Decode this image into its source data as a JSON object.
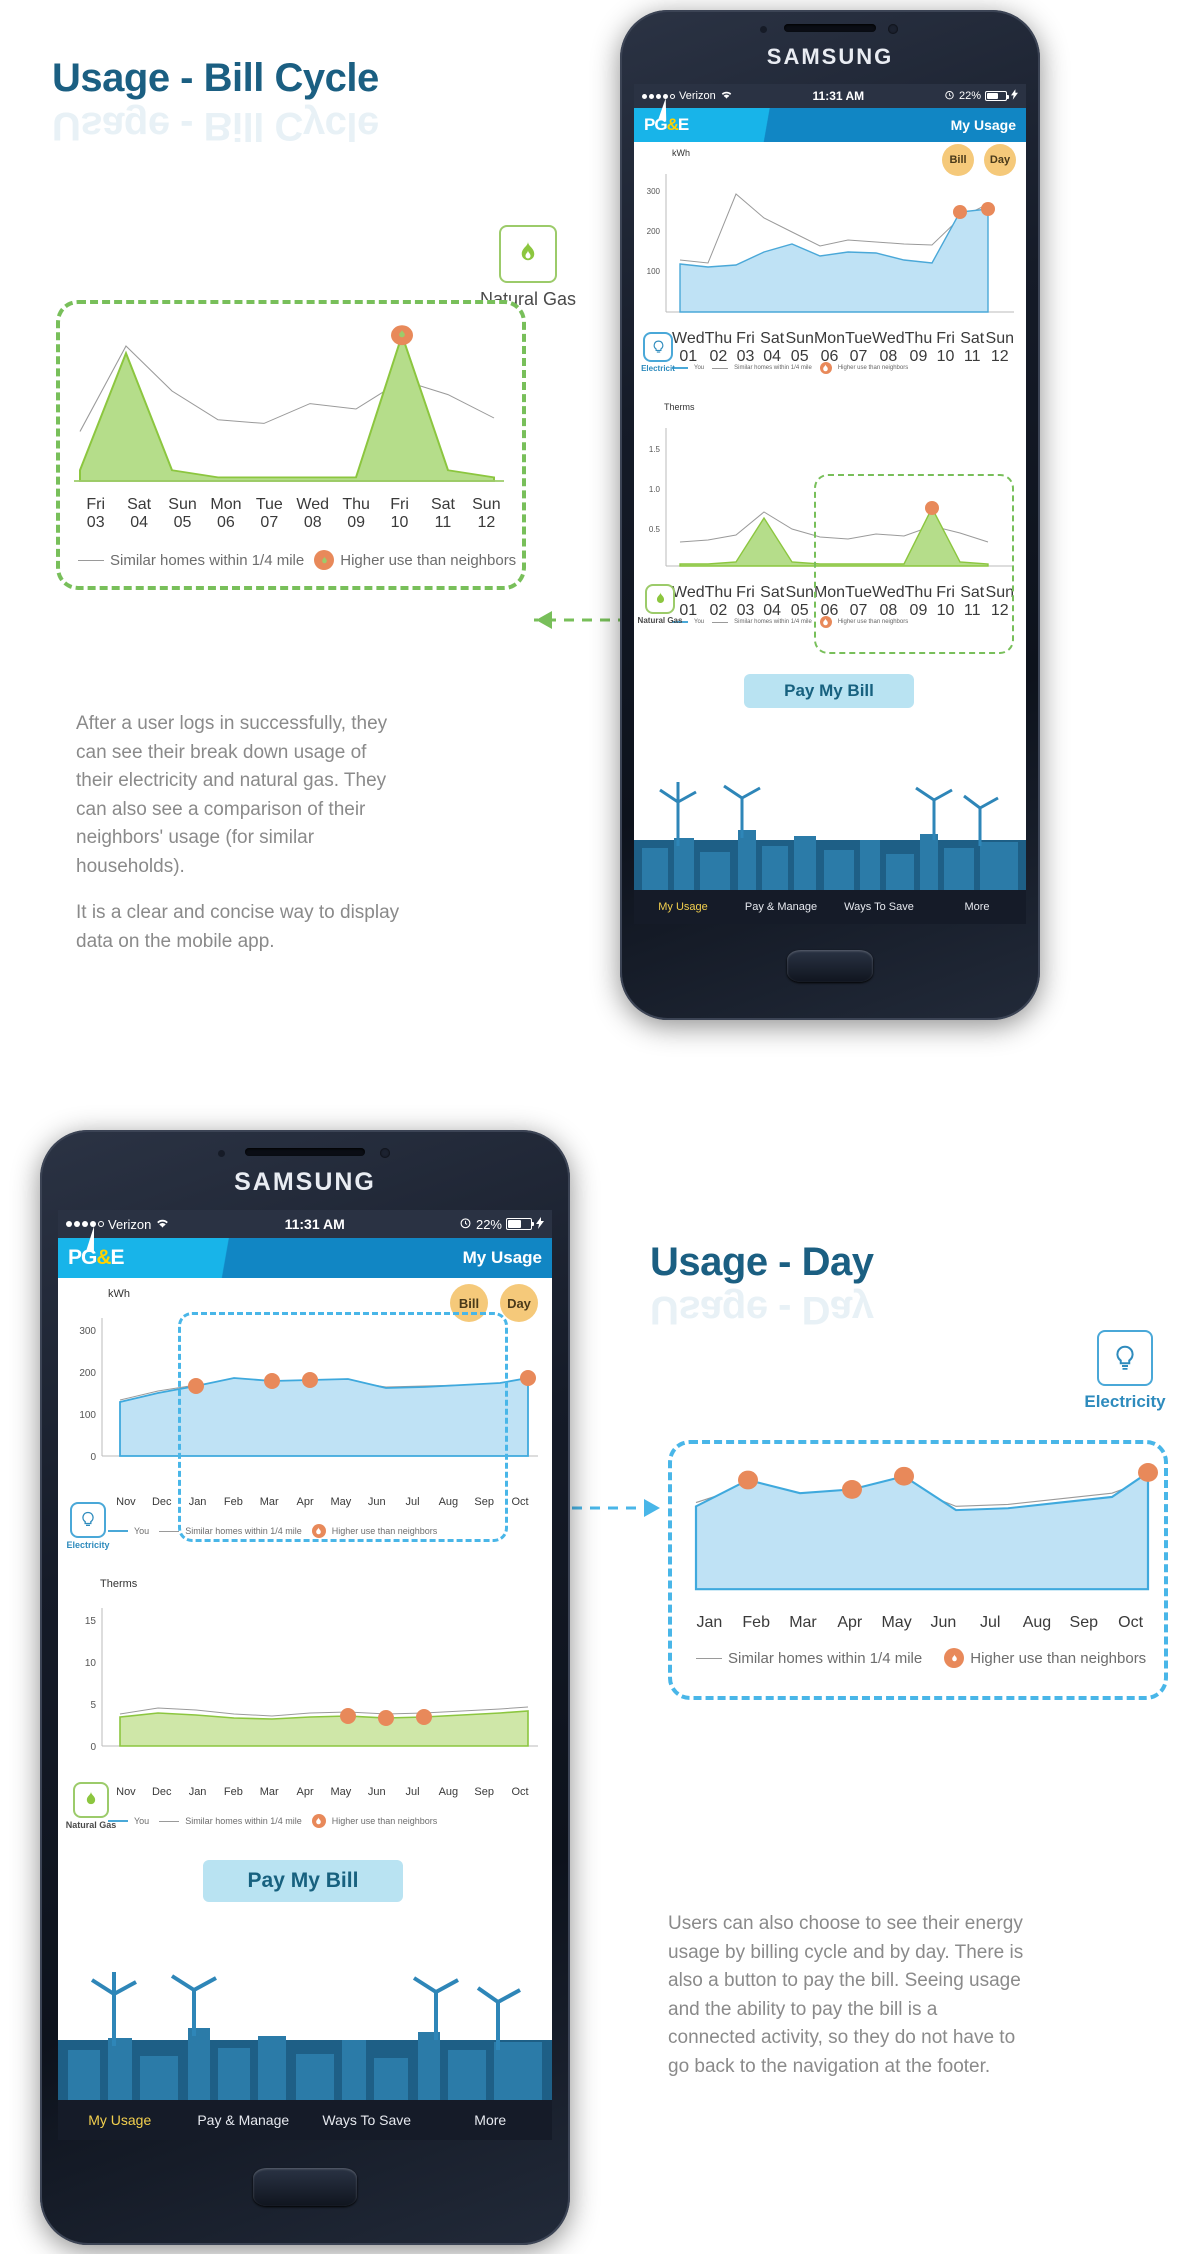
{
  "page": {
    "section1_title": "Usage - Bill Cycle",
    "section2_title": "Usage - Day",
    "body1_p1": "After a user logs in successfully, they can see their break down usage of their electricity and natural gas. They can also see a comparison of their neighbors' usage (for similar households).",
    "body1_p2": "It is a clear and concise way to display data on the mobile app.",
    "body2_p1": "Users can also choose to see their energy usage by billing cycle and by day. There is also a button to pay the bill. Seeing usage and the ability to pay the bill is a connected activity, so they do not have to go back to the navigation at the footer."
  },
  "colors": {
    "title_blue": "#1b5f82",
    "green_accent": "#78bf5a",
    "green_fill": "#b5dd8a",
    "blue_accent": "#49b6e8",
    "blue_fill": "#bfe2f5",
    "pin_orange": "#e8895a",
    "pge_cyan": "#18b4e9",
    "pge_blue": "#1186c4",
    "pill_amber": "#f5c97a",
    "pay_btn_bg": "#b9e3f2",
    "nav_active": "#f3d04e"
  },
  "device": {
    "brand": "SAMSUNG",
    "statusbar": {
      "carrier": "Verizon",
      "time": "11:31 AM",
      "battery_pct": "22%",
      "signal_dots_filled": 4,
      "signal_dots_total": 5,
      "wifi_icon": "wifi-icon",
      "alarm_icon": "alarm-clock-icon",
      "charging_icon": "lightning-bolt-icon"
    },
    "app_header": {
      "logo_pg": "PG",
      "logo_amp": "&",
      "logo_e": "E",
      "title": "My Usage"
    },
    "toggles": {
      "bill": "Bill",
      "day": "Day"
    },
    "pay_button": "Pay My Bill",
    "bottom_nav": [
      {
        "label": "My Usage",
        "active": true
      },
      {
        "label": "Pay & Manage",
        "active": false
      },
      {
        "label": "Ways To Save",
        "active": false
      },
      {
        "label": "More",
        "active": false
      }
    ]
  },
  "fuel": {
    "electricity_label": "Electricity",
    "electricity_label_short": "Electricit",
    "natural_gas_label": "Natural Gas",
    "electricity_icon": "lightbulb-icon",
    "natural_gas_icon": "gas-flame-icon"
  },
  "legend": {
    "you": "You",
    "similar": "Similar homes within 1/4 mile",
    "higher": "Higher use than neighbors",
    "pin_icon": "flame-pin-icon"
  },
  "chart_data": [
    {
      "id": "callout-bill-cycle-gas",
      "type": "area",
      "title": "Natural Gas",
      "ylabel": "",
      "xlabel": "",
      "categories": [
        "Fri\n03",
        "Sat\n04",
        "Sun\n05",
        "Mon\n06",
        "Tue\n07",
        "Wed\n08",
        "Thu\n09",
        "Fri\n10",
        "Sat\n11",
        "Sun\n12"
      ],
      "tick_days": [
        "Fri",
        "Sat",
        "Sun",
        "Mon",
        "Tue",
        "Wed",
        "Thu",
        "Fri",
        "Sat",
        "Sun"
      ],
      "tick_nums": [
        "03",
        "04",
        "05",
        "06",
        "07",
        "08",
        "09",
        "10",
        "11",
        "12"
      ],
      "series": [
        {
          "name": "You",
          "values": [
            0.05,
            0.72,
            0.05,
            0.03,
            0.03,
            0.03,
            0.03,
            0.95,
            0.05,
            0.03
          ]
        },
        {
          "name": "Similar homes within 1/4 mile",
          "values": [
            0.3,
            0.85,
            0.58,
            0.4,
            0.38,
            0.47,
            0.45,
            0.6,
            0.52,
            0.35
          ]
        }
      ],
      "markers": [
        {
          "x": 7,
          "y": 0.95,
          "label": "Higher use than neighbors"
        }
      ],
      "grid": false,
      "legend_position": "bottom"
    },
    {
      "id": "phone1-electricity",
      "type": "area",
      "title": "",
      "ylabel": "kWh",
      "ylim": [
        0,
        320
      ],
      "yticks": [
        100,
        200,
        300
      ],
      "categories": [
        "Wed 01",
        "Thu 02",
        "Fri 03",
        "Sat 04",
        "Sun 05",
        "Mon 06",
        "Tue 07",
        "Wed 08",
        "Thu 09",
        "Fri 10",
        "Sat 11",
        "Sun 12"
      ],
      "tick_days": [
        "Wed",
        "Thu",
        "Fri",
        "Sat",
        "Sun",
        "Mon",
        "Tue",
        "Wed",
        "Thu",
        "Fri",
        "Sat",
        "Sun"
      ],
      "tick_nums": [
        "01",
        "02",
        "03",
        "04",
        "05",
        "06",
        "07",
        "08",
        "09",
        "10",
        "11",
        "12"
      ],
      "series": [
        {
          "name": "You",
          "values": [
            120,
            112,
            118,
            150,
            170,
            140,
            150,
            148,
            130,
            122,
            250,
            258
          ]
        },
        {
          "name": "Similar homes within 1/4 mile",
          "values": [
            130,
            135,
            290,
            230,
            195,
            160,
            175,
            170,
            165,
            162,
            230,
            262
          ]
        }
      ],
      "markers": [
        {
          "x": 10,
          "y": 250
        },
        {
          "x": 11,
          "y": 262
        }
      ],
      "grid": false,
      "legend_position": "bottom"
    },
    {
      "id": "phone1-natural-gas",
      "type": "area",
      "title": "",
      "ylabel": "Therms",
      "ylim": [
        0,
        2.0
      ],
      "yticks": [
        0.5,
        1.0,
        1.5
      ],
      "categories": [
        "Wed 01",
        "Thu 02",
        "Fri 03",
        "Sat 04",
        "Sun 05",
        "Mon 06",
        "Tue 07",
        "Wed 08",
        "Thu 09",
        "Fri 10",
        "Sat 11",
        "Sun 12"
      ],
      "tick_days": [
        "Wed",
        "Thu",
        "Fri",
        "Sat",
        "Sun",
        "Mon",
        "Tue",
        "Wed",
        "Thu",
        "Fri",
        "Sat",
        "Sun"
      ],
      "tick_nums": [
        "01",
        "02",
        "03",
        "04",
        "05",
        "06",
        "07",
        "08",
        "09",
        "10",
        "11",
        "12"
      ],
      "series": [
        {
          "name": "You",
          "values": [
            0.03,
            0.03,
            0.05,
            0.6,
            0.05,
            0.03,
            0.03,
            0.03,
            0.03,
            0.72,
            0.05,
            0.03
          ]
        },
        {
          "name": "Similar homes within 1/4 mile",
          "values": [
            0.3,
            0.32,
            0.38,
            0.68,
            0.46,
            0.36,
            0.34,
            0.4,
            0.38,
            0.5,
            0.42,
            0.3
          ]
        }
      ],
      "markers": [
        {
          "x": 9,
          "y": 0.72
        }
      ],
      "grid": false,
      "legend_position": "bottom"
    },
    {
      "id": "phone2-electricity",
      "type": "area",
      "title": "",
      "ylabel": "kWh",
      "ylim": [
        0,
        320
      ],
      "yticks": [
        100,
        200,
        300
      ],
      "categories": [
        "Nov",
        "Dec",
        "Jan",
        "Feb",
        "Mar",
        "Apr",
        "May",
        "Jun",
        "Jul",
        "Aug",
        "Sep",
        "Oct"
      ],
      "series": [
        {
          "name": "You",
          "values": [
            130,
            150,
            165,
            185,
            178,
            180,
            183,
            160,
            162,
            168,
            172,
            185
          ]
        },
        {
          "name": "Similar homes within 1/4 mile",
          "values": [
            135,
            155,
            170,
            180,
            176,
            178,
            180,
            165,
            166,
            170,
            174,
            182
          ]
        }
      ],
      "markers": [
        {
          "x": 2,
          "y": 165
        },
        {
          "x": 4,
          "y": 178
        },
        {
          "x": 5,
          "y": 180
        },
        {
          "x": 11,
          "y": 185
        }
      ],
      "grid": false,
      "legend_position": "bottom"
    },
    {
      "id": "phone2-natural-gas",
      "type": "area",
      "title": "",
      "ylabel": "Therms",
      "ylim": [
        0,
        17
      ],
      "yticks": [
        5,
        10,
        15
      ],
      "categories": [
        "Nov",
        "Dec",
        "Jan",
        "Feb",
        "Mar",
        "Apr",
        "May",
        "Jun",
        "Jul",
        "Aug",
        "Sep",
        "Oct"
      ],
      "series": [
        {
          "name": "You",
          "values": [
            3.6,
            4.0,
            3.8,
            3.5,
            3.4,
            3.6,
            3.7,
            3.5,
            3.6,
            3.8,
            4.0,
            4.2
          ]
        },
        {
          "name": "Similar homes within 1/4 mile",
          "values": [
            3.9,
            4.4,
            4.2,
            3.8,
            3.7,
            3.9,
            4.0,
            3.8,
            3.9,
            4.1,
            4.3,
            4.5
          ]
        }
      ],
      "markers": [
        {
          "x": 6,
          "y": 3.7
        },
        {
          "x": 7,
          "y": 3.5
        },
        {
          "x": 8,
          "y": 3.6
        }
      ],
      "grid": false,
      "legend_position": "bottom"
    },
    {
      "id": "callout-day-electricity",
      "type": "area",
      "title": "Electricity",
      "ylabel": "",
      "categories": [
        "Jan",
        "Feb",
        "Mar",
        "Apr",
        "May",
        "Jun",
        "Jul",
        "Aug",
        "Sep",
        "Oct"
      ],
      "series": [
        {
          "name": "You",
          "values": [
            168,
            190,
            180,
            182,
            192,
            166,
            168,
            172,
            176,
            196
          ]
        },
        {
          "name": "Similar homes within 1/4 mile",
          "values": [
            172,
            184,
            178,
            180,
            184,
            170,
            171,
            174,
            178,
            188
          ]
        }
      ],
      "markers": [
        {
          "x": 1,
          "y": 190
        },
        {
          "x": 3,
          "y": 182
        },
        {
          "x": 4,
          "y": 192
        },
        {
          "x": 9,
          "y": 196
        }
      ],
      "grid": false,
      "legend_position": "bottom"
    }
  ]
}
